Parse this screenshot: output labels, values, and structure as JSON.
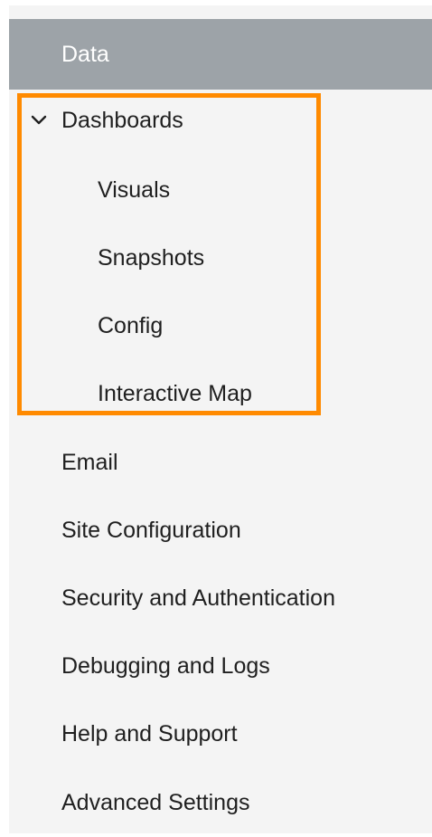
{
  "sidebar": {
    "items": [
      {
        "label": "Data"
      },
      {
        "label": "Dashboards"
      },
      {
        "label": "Visuals"
      },
      {
        "label": "Snapshots"
      },
      {
        "label": "Config"
      },
      {
        "label": "Interactive Map"
      },
      {
        "label": "Email"
      },
      {
        "label": "Site Configuration"
      },
      {
        "label": "Security and Authentication"
      },
      {
        "label": "Debugging and Logs"
      },
      {
        "label": "Help and Support"
      },
      {
        "label": "Advanced Settings"
      }
    ]
  },
  "colors": {
    "selected_bg": "#9da3a8",
    "highlight_border": "#ff8a00",
    "sidebar_bg": "#f4f4f4",
    "text": "#1f1f1f"
  },
  "icons": {
    "expand": "chevron-down-icon"
  }
}
